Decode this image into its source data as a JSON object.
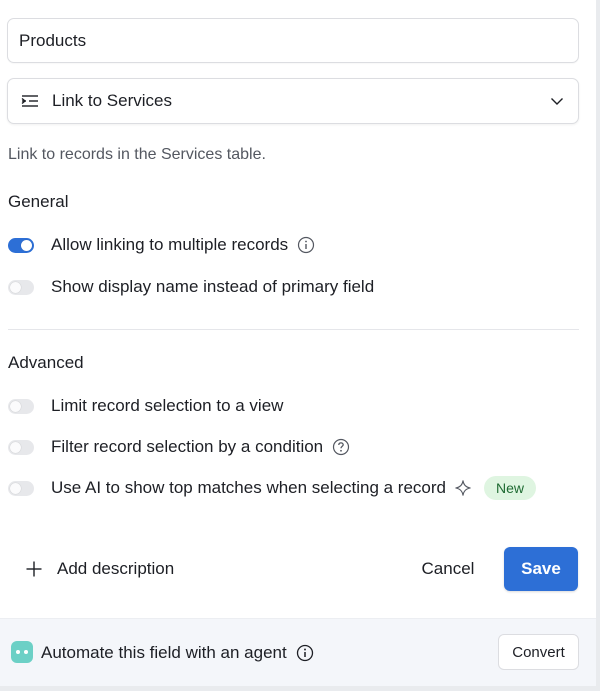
{
  "field_name": {
    "value": "Products"
  },
  "field_type": {
    "label": "Link to Services",
    "icon": "link-lines-icon"
  },
  "description": "Link to records in the Services table.",
  "general": {
    "title": "General",
    "options": [
      {
        "label": "Allow linking to multiple records",
        "enabled": true,
        "has_info": true
      },
      {
        "label": "Show display name instead of primary field",
        "enabled": false
      }
    ]
  },
  "advanced": {
    "title": "Advanced",
    "options": [
      {
        "label": "Limit record selection to a view",
        "enabled": false
      },
      {
        "label": "Filter record selection by a condition",
        "enabled": false,
        "has_help": true
      },
      {
        "label": "Use AI to show top matches when selecting a record",
        "enabled": false,
        "badge": "New"
      }
    ]
  },
  "actions": {
    "add_description": "Add description",
    "cancel": "Cancel",
    "save": "Save"
  },
  "footer": {
    "text": "Automate this field with an agent",
    "convert": "Convert"
  },
  "colors": {
    "accent": "#2d6fd6",
    "badge_bg": "#dff5e1",
    "agent_icon": "#6cd0c6"
  }
}
